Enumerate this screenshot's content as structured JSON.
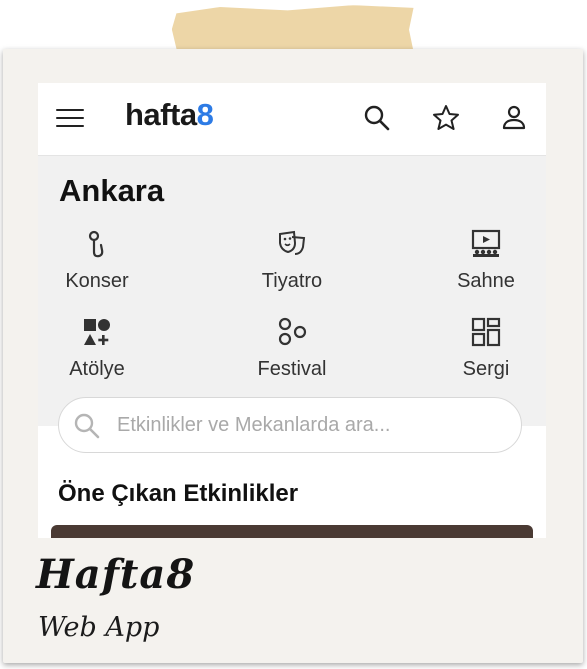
{
  "header": {
    "logo_main": "hafta",
    "logo_accent": "8",
    "icons": [
      "menu-icon",
      "search-icon",
      "star-icon",
      "user-icon"
    ]
  },
  "city": "Ankara",
  "categories": [
    {
      "label": "Konser",
      "icon": "microphone-icon"
    },
    {
      "label": "Tiyatro",
      "icon": "theater-mask-icon"
    },
    {
      "label": "Sahne",
      "icon": "stage-icon"
    },
    {
      "label": "Atölye",
      "icon": "shapes-icon"
    },
    {
      "label": "Festival",
      "icon": "festival-icon"
    },
    {
      "label": "Sergi",
      "icon": "gallery-icon"
    }
  ],
  "search": {
    "placeholder": "Etkinlikler ve Mekanlarda ara..."
  },
  "featured": {
    "title": "Öne Çıkan Etkinlikler"
  },
  "caption": {
    "title": "Hafta8",
    "subtitle": "Web App"
  },
  "colors": {
    "accent": "#2d7be5",
    "tape": "#ecd4a2",
    "frame": "#f4f2ee"
  }
}
